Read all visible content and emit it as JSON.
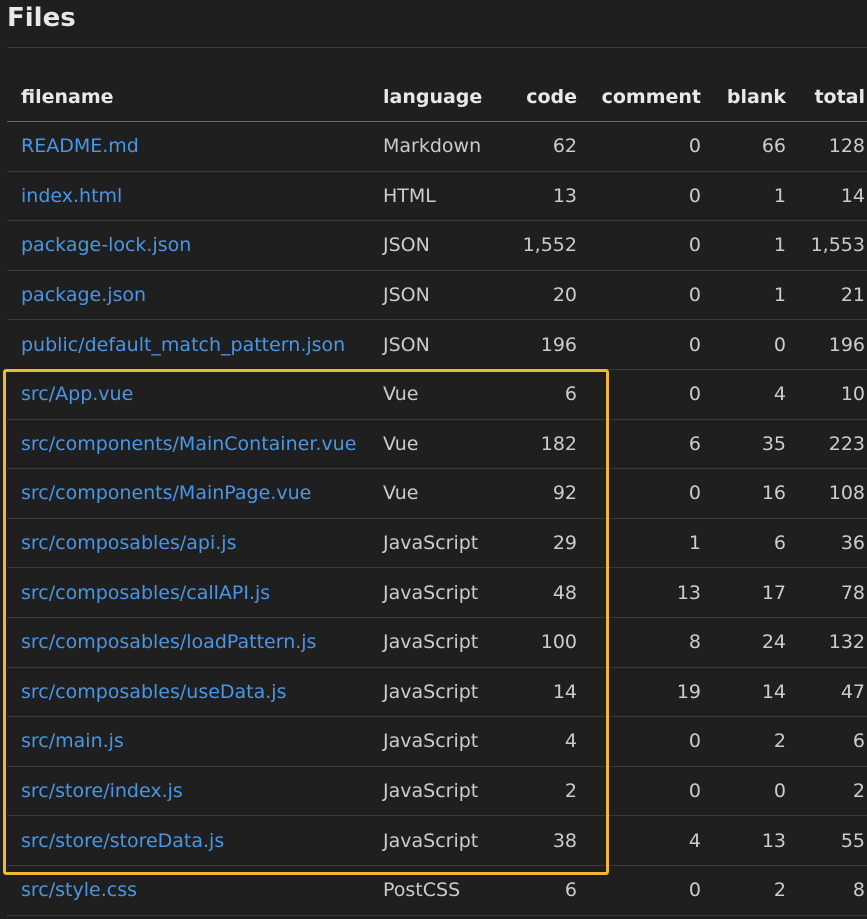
{
  "page": {
    "title": "Files"
  },
  "table": {
    "columns": {
      "filename": "filename",
      "language": "language",
      "code": "code",
      "comment": "comment",
      "blank": "blank",
      "total": "total"
    },
    "rows": [
      {
        "filename": "README.md",
        "language": "Markdown",
        "code": "62",
        "comment": "0",
        "blank": "66",
        "total": "128"
      },
      {
        "filename": "index.html",
        "language": "HTML",
        "code": "13",
        "comment": "0",
        "blank": "1",
        "total": "14"
      },
      {
        "filename": "package-lock.json",
        "language": "JSON",
        "code": "1,552",
        "comment": "0",
        "blank": "1",
        "total": "1,553"
      },
      {
        "filename": "package.json",
        "language": "JSON",
        "code": "20",
        "comment": "0",
        "blank": "1",
        "total": "21"
      },
      {
        "filename": "public/default_match_pattern.json",
        "language": "JSON",
        "code": "196",
        "comment": "0",
        "blank": "0",
        "total": "196"
      },
      {
        "filename": "src/App.vue",
        "language": "Vue",
        "code": "6",
        "comment": "0",
        "blank": "4",
        "total": "10"
      },
      {
        "filename": "src/components/MainContainer.vue",
        "language": "Vue",
        "code": "182",
        "comment": "6",
        "blank": "35",
        "total": "223"
      },
      {
        "filename": "src/components/MainPage.vue",
        "language": "Vue",
        "code": "92",
        "comment": "0",
        "blank": "16",
        "total": "108"
      },
      {
        "filename": "src/composables/api.js",
        "language": "JavaScript",
        "code": "29",
        "comment": "1",
        "blank": "6",
        "total": "36"
      },
      {
        "filename": "src/composables/callAPI.js",
        "language": "JavaScript",
        "code": "48",
        "comment": "13",
        "blank": "17",
        "total": "78"
      },
      {
        "filename": "src/composables/loadPattern.js",
        "language": "JavaScript",
        "code": "100",
        "comment": "8",
        "blank": "24",
        "total": "132"
      },
      {
        "filename": "src/composables/useData.js",
        "language": "JavaScript",
        "code": "14",
        "comment": "19",
        "blank": "14",
        "total": "47"
      },
      {
        "filename": "src/main.js",
        "language": "JavaScript",
        "code": "4",
        "comment": "0",
        "blank": "2",
        "total": "6"
      },
      {
        "filename": "src/store/index.js",
        "language": "JavaScript",
        "code": "2",
        "comment": "0",
        "blank": "0",
        "total": "2"
      },
      {
        "filename": "src/store/storeData.js",
        "language": "JavaScript",
        "code": "38",
        "comment": "4",
        "blank": "13",
        "total": "55"
      },
      {
        "filename": "src/style.css",
        "language": "PostCSS",
        "code": "6",
        "comment": "0",
        "blank": "2",
        "total": "8"
      }
    ]
  },
  "colors": {
    "background": "#1f1f1f",
    "link": "#4a96e6",
    "highlight": "#f0b930"
  }
}
